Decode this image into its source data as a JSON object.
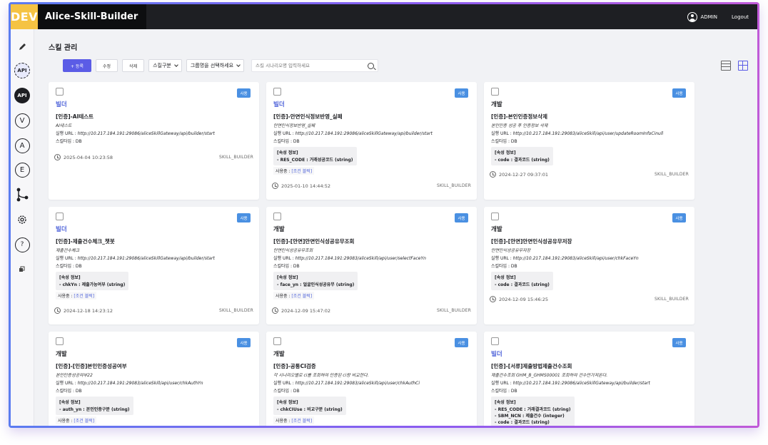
{
  "header": {
    "badge": "DEV",
    "title": "Alice-Skill-Builder",
    "user": "ADMIN",
    "logout": "Logout"
  },
  "sidebar": {
    "items": [
      {
        "label": "API",
        "icon": "api-outline-icon"
      },
      {
        "label": "API",
        "icon": "api-solid-icon"
      },
      {
        "label": "V",
        "icon": "v-circle-icon"
      },
      {
        "label": "A",
        "icon": "a-circle-icon"
      },
      {
        "label": "E",
        "icon": "e-circle-icon"
      },
      {
        "label": "?",
        "icon": "help-icon"
      }
    ]
  },
  "page": {
    "title": "스킬 관리"
  },
  "toolbar": {
    "add": "+ 등록",
    "edit": "수정",
    "delete": "삭제",
    "skill_type": "스킬구분",
    "group": "그룹명을 선택하세요",
    "search_placeholder": "스킬 시나리오명 입력하세요"
  },
  "labels": {
    "url": "실행 URL : ",
    "type": "스킬타입 : ",
    "attr_header": "[속성 정보]",
    "usage": "사용중 : ",
    "usage_link": "[조건 블럭]"
  },
  "colors": {
    "accent": "#5b5ce6",
    "badge": "#4a90e2",
    "builder": "#4a5fd8",
    "topbar": "#1e1f23",
    "dev": "#f5c343"
  },
  "cards": [
    {
      "status": "사용",
      "category": "빌더",
      "name": "[인증]-AI테스트",
      "desc": "AI테스트",
      "url": "http://10.217.184.191:29086/aliceSkillGateway/api/builder/start",
      "type": "DB",
      "attrs": [],
      "usage": false,
      "date": "2025-04-04 10:23:58",
      "owner": "SKILL_BUILDER"
    },
    {
      "status": "사용",
      "category": "빌더",
      "name": "[인증]-안면인식정보반영_실패",
      "desc": "안면인식정보반영_실패",
      "url": "http://10.217.184.191:29086/aliceSkillGateway/api/builder/start",
      "type": "DB",
      "attrs": [
        "- RES_CODE : 거래성공코드 (string)"
      ],
      "usage": true,
      "date": "2025-01-10 14:44:52",
      "owner": "SKILL_BUILDER"
    },
    {
      "status": "사용",
      "category": "개발",
      "name": "[인증]-본인인증정보삭제",
      "desc": "본인인증 성공 후 인증정보 삭제",
      "url": "http://10.217.184.191:29083/aliceSkill/api/user/updateRoomInfoCinull",
      "type": "DB",
      "attrs": [
        "- code : 결과코드 (string)"
      ],
      "usage": false,
      "date": "2024-12-27 09:37:01",
      "owner": "SKILL_BUILDER"
    },
    {
      "status": "사용",
      "category": "빌더",
      "name": "[인증]-제출건수체크_챗봇",
      "desc": "제출건수체크",
      "url": "http://10.217.184.191:29086/aliceSkillGateway/api/builder/start",
      "type": "DB",
      "attrs": [
        "- chkYn : 제출가능여부 (string)"
      ],
      "usage": true,
      "date": "2024-12-18 14:23:12",
      "owner": "SKILL_BUILDER"
    },
    {
      "status": "사용",
      "category": "개발",
      "name": "[인증]-[안면]안면인식성공유무조회",
      "desc": "안면인식성공유무조회",
      "url": "http://10.217.184.191:29083/aliceSkill/api/user/selectFaceYn",
      "type": "DB",
      "attrs": [
        "- face_yn : 얼굴인식성공유무 (string)"
      ],
      "usage": true,
      "date": "2024-12-09 15:47:02",
      "owner": "SKILL_BUILDER"
    },
    {
      "status": "사용",
      "category": "개발",
      "name": "[인증]-[안면]안면인식성공유무저장",
      "desc": "안면인식성공유무저장",
      "url": "http://10.217.184.191:29083/aliceSkill/api/user/chkFaceYn",
      "type": "DB",
      "attrs": [
        "- code : 결과코드 (string)"
      ],
      "usage": false,
      "date": "2024-12-09 15:46:25",
      "owner": "SKILL_BUILDER"
    },
    {
      "status": "사용",
      "category": "개발",
      "name": "[인증]-[인증]본인인증성공여부",
      "desc": "본인인증성공여부22",
      "url": "http://10.217.184.191:29083/aliceSkill/api/user/chkAuthYn",
      "type": "DB",
      "attrs": [
        "- auth_yn : 본인인증구분 (string)"
      ],
      "usage": true,
      "date": "",
      "owner": ""
    },
    {
      "status": "사용",
      "category": "개발",
      "name": "[인증]-공통CI검증",
      "desc": "각 시나리오별로 ci를 조회하여 인증된 ci랑 비교한다.",
      "url": "http://10.217.184.191:29083/aliceSkill/api/user/chkAuthCi",
      "type": "DB",
      "attrs": [
        "- chkCIUse : 비교구분 (string)"
      ],
      "usage": true,
      "date": "",
      "owner": ""
    },
    {
      "status": "사용",
      "category": "빌더",
      "name": "[인증]-[서류]제출방법제출건수조회",
      "desc": "제출건수조회 GHM_B_GHMS00001 조회하여 건수만가져온다.",
      "url": "http://10.217.184.191:29086/aliceSkillGateway/api/builder/start",
      "type": "DB",
      "attrs": [
        "- RES_CODE : 거래결과코드 (string)",
        "- SBM_NCN : 제출건수 (integer)",
        "- code : 결과코드 (string)"
      ],
      "usage": false,
      "date": "",
      "owner": ""
    }
  ]
}
